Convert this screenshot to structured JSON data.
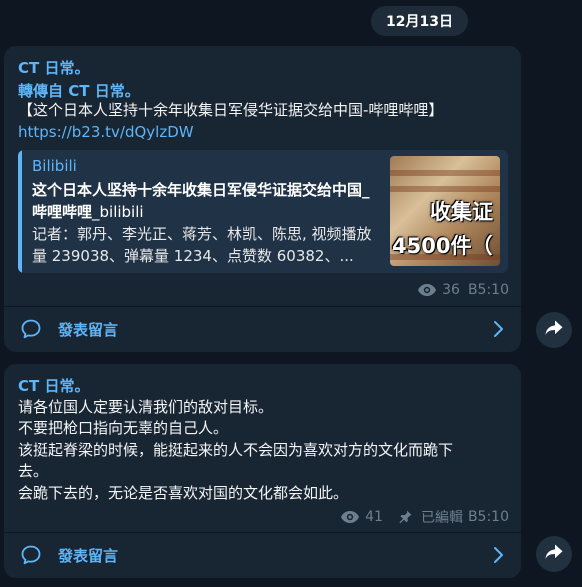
{
  "date_label": "12月13日",
  "messages": [
    {
      "sender": "CT 日常。",
      "forwarded_prefix": "轉傳自 ",
      "forwarded_from": "CT 日常。",
      "text": "【这个日本人坚持十余年收集日军侵华证据交给中国-哔哩哔哩】",
      "link": "https://b23.tv/dQylzDW",
      "preview": {
        "site": "Bilibili",
        "title": "这个日本人坚持十余年收集日军侵华证据交给中国_哔哩哔哩",
        "title_suffix": "_bilibili",
        "description": "记者：郭丹、李光正、蒋芳、林凯、陈思, 视频播放量 239038、弹幕量 1234、点赞数 60382、...",
        "thumb_text_1": "收集证",
        "thumb_text_2": "4500件（"
      },
      "views": "36",
      "time": "B5:10",
      "comment_label": "發表留言"
    },
    {
      "sender": "CT 日常。",
      "lines": [
        "请各位国人定要认清我们的敌对目标。",
        "不要把枪口指向无辜的自己人。",
        "该挺起脊梁的时候，能挺起来的人不会因为喜欢对方的文化而跪下",
        "去。",
        "会跪下去的，无论是否喜欢对国的文化都会如此。"
      ],
      "views": "41",
      "edited_label": "已編輯",
      "time": "B5:10",
      "comment_label": "發表留言"
    }
  ],
  "icons": {
    "views": "eye-icon",
    "pinned": "pin-icon",
    "comment": "comment-bubble-icon",
    "chevron": "chevron-right-icon",
    "share": "share-arrow-icon"
  },
  "colors": {
    "background": "#0e1621",
    "bubble": "#182533",
    "accent": "#5eb5f7",
    "meta": "#6d7f8f"
  }
}
